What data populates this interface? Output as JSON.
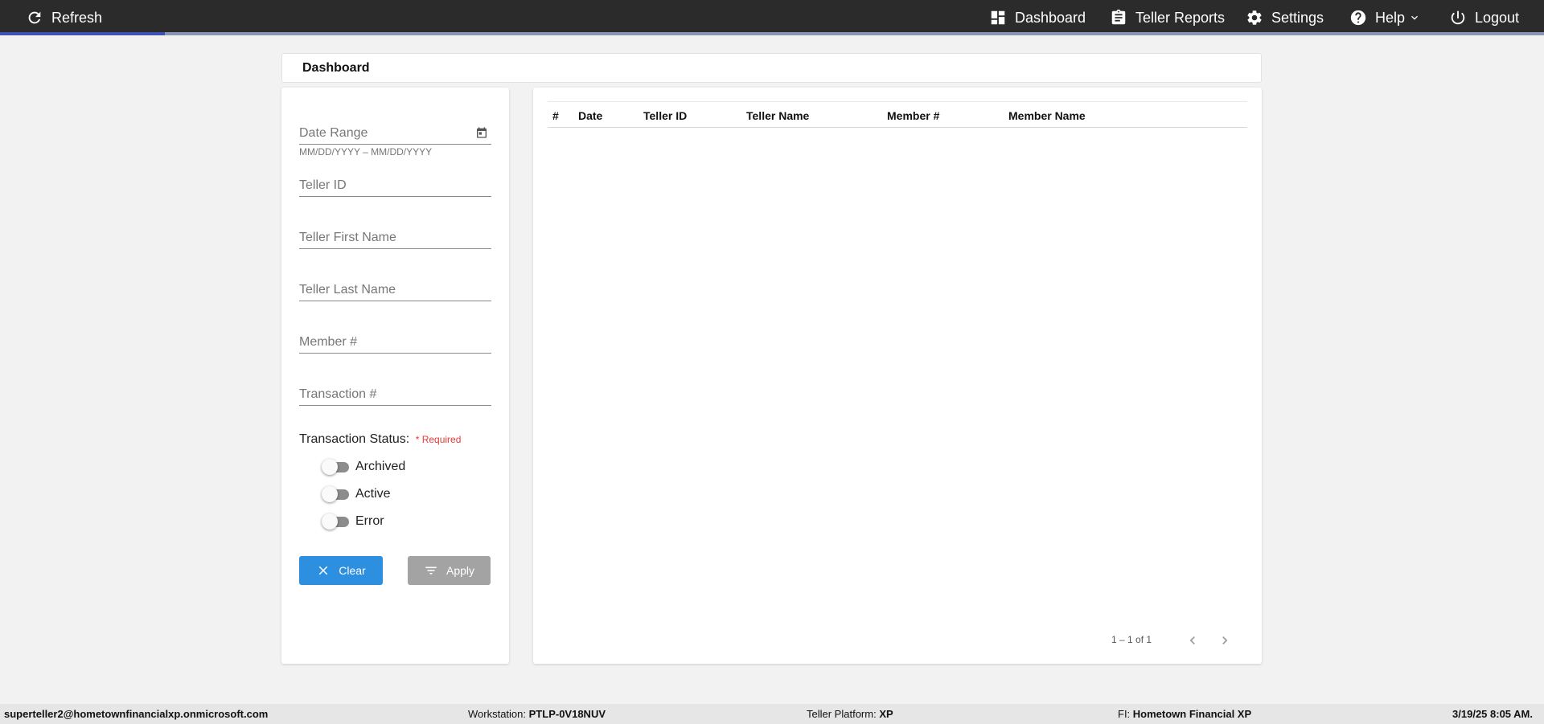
{
  "topbar": {
    "refresh_label": "Refresh",
    "progress_fraction": 0.107,
    "nav": {
      "dashboard": "Dashboard",
      "teller_reports": "Teller Reports",
      "settings": "Settings",
      "help": "Help",
      "logout": "Logout"
    }
  },
  "page_title": "Dashboard",
  "filters": {
    "date_range_placeholder": "Date Range",
    "date_range_hint": "MM/DD/YYYY – MM/DD/YYYY",
    "teller_id_placeholder": "Teller ID",
    "teller_first_name_placeholder": "Teller First Name",
    "teller_last_name_placeholder": "Teller Last Name",
    "member_number_placeholder": "Member #",
    "transaction_number_placeholder": "Transaction #",
    "status_label": "Transaction Status:",
    "required_label": "* Required",
    "toggles": {
      "archived": "Archived",
      "active": "Active",
      "error": "Error"
    },
    "clear_label": "Clear",
    "apply_label": "Apply"
  },
  "table": {
    "columns": {
      "index": "#",
      "date": "Date",
      "teller_id": "Teller ID",
      "teller_name": "Teller Name",
      "member_number": "Member #",
      "member_name": "Member Name"
    },
    "rows": []
  },
  "pager": {
    "range_text": "1 – 1 of 1"
  },
  "footer": {
    "user": "superteller2@hometownfinancialxp.onmicrosoft.com",
    "workstation_label": "Workstation:",
    "workstation_value": "PTLP-0V18NUV",
    "platform_label": "Teller Platform:",
    "platform_value": "XP",
    "fi_label": "FI:",
    "fi_value": "Hometown Financial XP",
    "datetime": "3/19/25 8:05 AM."
  },
  "colors": {
    "topbar": "#2b2b2b",
    "progress": "#3f51b5",
    "clear_button": "#2c8fe0",
    "apply_button": "#a3a3a3",
    "required": "#e53935"
  }
}
